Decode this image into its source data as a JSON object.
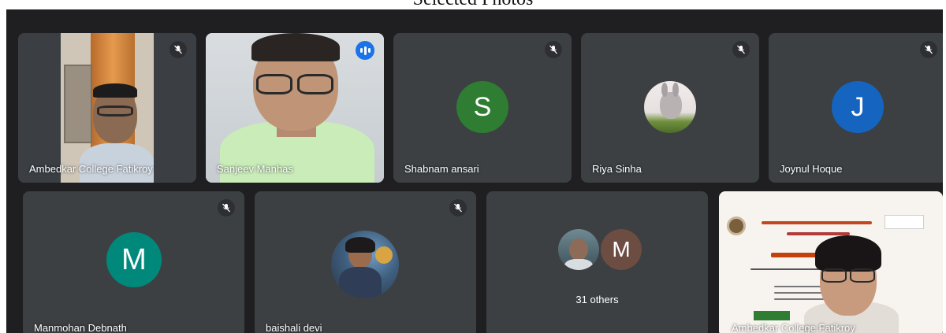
{
  "caption": "Selected Photos",
  "participants": {
    "ambedkar_top": {
      "name": "Ambedkar College Fatikroy"
    },
    "sanjeev": {
      "name": "Sanjeev Manhas"
    },
    "shabnam": {
      "name": "Shabnam ansari",
      "initial": "S",
      "color": "#2e7d32"
    },
    "riya": {
      "name": "Riya Sinha"
    },
    "joynul": {
      "name": "Joynul Hoque",
      "initial": "J",
      "color": "#1565c0"
    },
    "manmohan": {
      "name": "Manmohan Debnath",
      "initial": "M",
      "color": "#00897b"
    },
    "baishali": {
      "name": "baishali devi"
    },
    "others": {
      "label": "31 others",
      "initial": "M",
      "color": "#6d4c41"
    },
    "ambedkar_bottom": {
      "name": "Ambedkar College Fatikroy"
    }
  },
  "icons": {
    "muted": "mic-off-icon",
    "speaking": "audio-level-icon"
  }
}
